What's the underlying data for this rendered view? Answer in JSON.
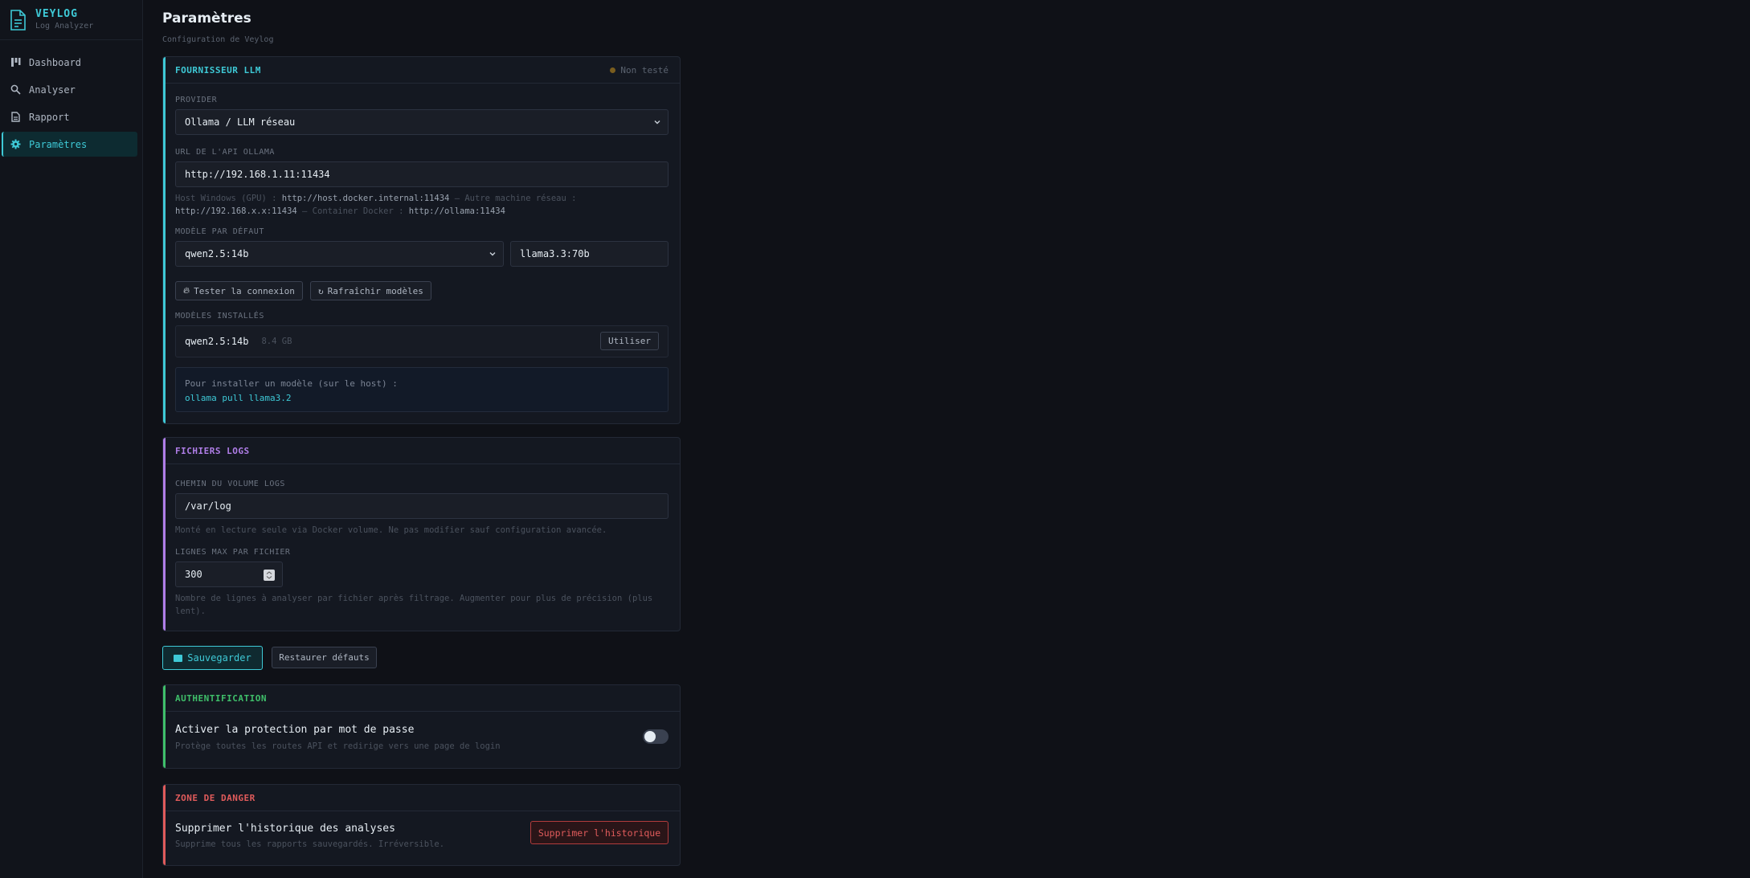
{
  "brand": {
    "name": "VEYLOG",
    "subtitle": "Log Analyzer"
  },
  "sidebar": {
    "items": [
      {
        "label": "Dashboard",
        "icon": "dashboard-icon"
      },
      {
        "label": "Analyser",
        "icon": "search-icon"
      },
      {
        "label": "Rapport",
        "icon": "document-icon"
      },
      {
        "label": "Paramètres",
        "icon": "gear-icon",
        "active": true
      }
    ]
  },
  "page": {
    "title": "Paramètres",
    "subtitle": "Configuration de Veylog"
  },
  "llm": {
    "title": "FOURNISSEUR LLM",
    "status": "Non testé",
    "provider_label": "PROVIDER",
    "provider_value": "Ollama / LLM réseau",
    "url_label": "URL DE L'API OLLAMA",
    "url_value": "http://192.168.1.11:11434",
    "hint_a": "Host Windows (GPU) : ",
    "hint_b": "http://host.docker.internal:11434",
    "hint_c": " — Autre machine réseau :",
    "hint_d": "http://192.168.x.x:11434",
    "hint_e": " — Container Docker : ",
    "hint_f": "http://ollama:11434",
    "model_label": "MODÈLE PAR DÉFAUT",
    "model_select": "qwen2.5:14b",
    "model_custom": "llama3.3:70b",
    "test_button": "Tester la connexion",
    "refresh_button": "Rafraîchir modèles",
    "installed_label": "MODÈLES INSTALLÉS",
    "installed": [
      {
        "name": "qwen2.5:14b",
        "size": "8.4 GB",
        "action": "Utiliser"
      }
    ],
    "install_info": "Pour installer un modèle (sur le host) :",
    "install_cmd": "ollama pull llama3.2"
  },
  "logs": {
    "title": "FICHIERS LOGS",
    "path_label": "CHEMIN DU VOLUME LOGS",
    "path_value": "/var/log",
    "path_hint": "Monté en lecture seule via Docker volume. Ne pas modifier sauf configuration avancée.",
    "lines_label": "LIGNES MAX PAR FICHIER",
    "lines_value": "300",
    "lines_hint_1": "Nombre de lignes à analyser par fichier après filtrage. Augmenter pour plus de précision (plus",
    "lines_hint_2": "lent)."
  },
  "actions": {
    "save": "Sauvegarder",
    "reset": "Restaurer défauts"
  },
  "auth": {
    "title": "AUTHENTIFICATION",
    "toggle_title": "Activer la protection par mot de passe",
    "toggle_sub": "Protège toutes les routes API et redirige vers une page de login",
    "enabled": false
  },
  "danger": {
    "title": "ZONE DE DANGER",
    "row_title": "Supprimer l'historique des analyses",
    "row_sub": "Supprime tous les rapports sauvegardés. Irréversible.",
    "button": "Supprimer l'historique"
  },
  "colors": {
    "accent": "#3ec9d6",
    "logs": "#b07ee8",
    "auth": "#3fbf6a",
    "danger": "#e05b5b"
  }
}
